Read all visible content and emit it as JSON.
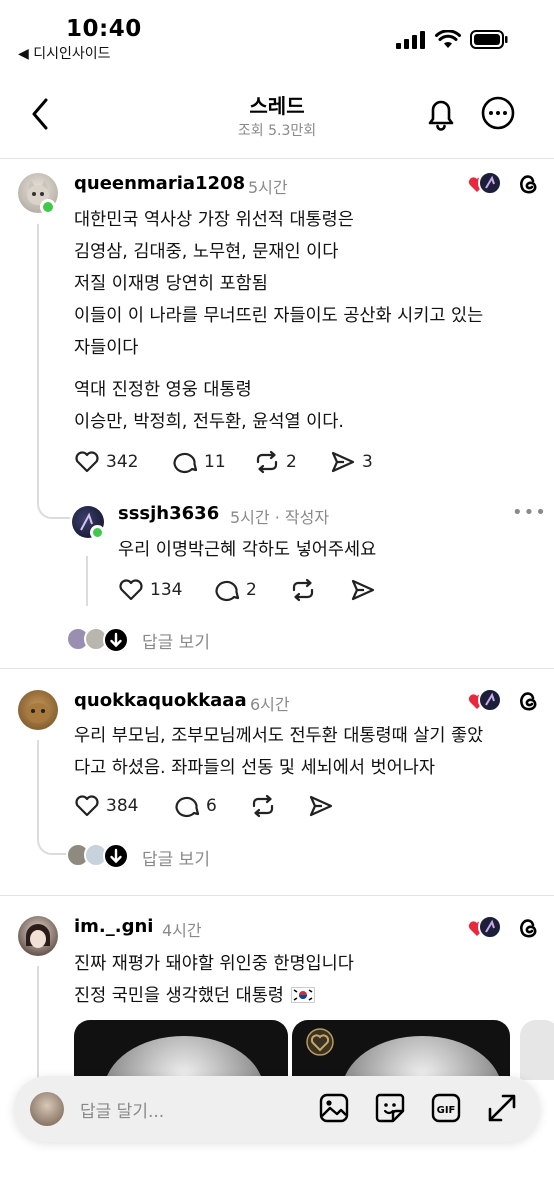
{
  "status": {
    "time": "10:40",
    "back_app": "◀ 디시인사이드"
  },
  "header": {
    "title": "스레드",
    "subtitle": "조회 5.3만회"
  },
  "posts": [
    {
      "username": "queenmaria1208",
      "time": "5시간",
      "lines": [
        "대한민국 역사상 가장 위선적 대통령은",
        "김영삼, 김대중, 노무현, 문재인 이다",
        "저질 이재명 당연히 포함됨",
        "이들이 이 나라를 무너뜨린 자들이도 공산화 시키고 있는",
        "자들이다",
        "역대 진정한 영웅 대통령",
        "이승만, 박정희, 전두환, 윤석열 이다."
      ],
      "likes": "342",
      "comments": "11",
      "reposts": "2",
      "shares": "3"
    },
    {
      "username": "sssjh3636",
      "time": "5시간 · 작성자",
      "lines": [
        "우리 이명박근혜 각하도 넣어주세요"
      ],
      "likes": "134",
      "comments": "2"
    },
    {
      "username": "quokkaquokkaaa",
      "time": "6시간",
      "lines": [
        "우리 부모님, 조부모님께서도 전두환 대통령때 살기 좋았",
        "다고 하셨음. 좌파들의 선동 및 세뇌에서 벗어나자"
      ],
      "likes": "384",
      "comments": "6"
    },
    {
      "username": "im._.gni",
      "time": "4시간",
      "lines": [
        "진짜 재평가 돼야할 위인중 한명입니다",
        "진정 국민을 생각했던 대통령"
      ]
    }
  ],
  "view_replies": "답글 보기",
  "composer": {
    "placeholder": "답글 달기..."
  },
  "colors": {
    "online": "#3ec94a",
    "heart": "#e8283c",
    "muted": "#8a8a8a"
  }
}
